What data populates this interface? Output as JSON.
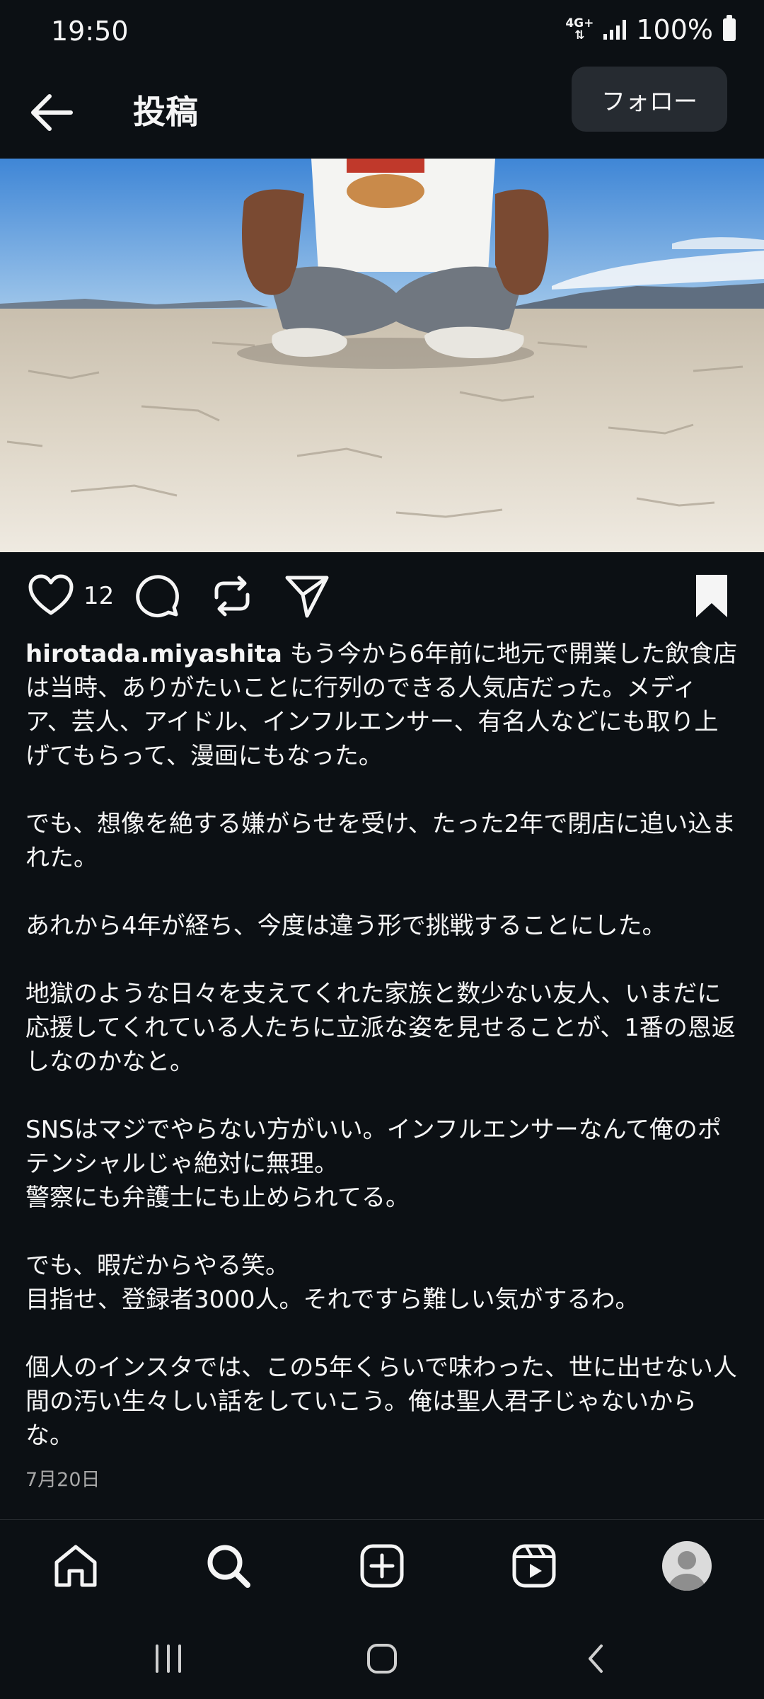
{
  "status_bar": {
    "time": "19:50",
    "network": "4G+",
    "battery": "100%"
  },
  "header": {
    "title": "投稿",
    "follow_label": "フォロー",
    "back_icon": "arrow-left-icon"
  },
  "post": {
    "like_count": "12",
    "username": "hirotada.miyashita",
    "caption_paragraphs": [
      [
        "もう今から6年前に地元で開業した飲食店は当時、ありがたいことに行列のできる人気店だった。メディア、芸人、アイドル、インフルエンサー、有名人などにも取り上げてもらって、漫画にもなった。"
      ],
      [
        "でも、想像を絶する嫌がらせを受け、たった2年で閉店に追い込まれた。"
      ],
      [
        "あれから4年が経ち、今度は違う形で挑戦することにした。"
      ],
      [
        "地獄のような日々を支えてくれた家族と数少ない友人、いまだに応援してくれている人たちに立派な姿を見せることが、1番の恩返しなのかなと。"
      ],
      [
        "SNSはマジでやらない方がいい。インフルエンサーなんて俺のポテンシャルじゃ絶対に無理。",
        "警察にも弁護士にも止められてる。"
      ],
      [
        "でも、暇だからやる笑。",
        "目指せ、登録者3000人。それですら難しい気がするわ。"
      ],
      [
        "個人のインスタでは、この5年くらいで味わった、世に出せない人間の汚い生々しい話をしていこう。俺は聖人君子じゃないからな。"
      ]
    ],
    "date": "7月20日"
  },
  "icons": {
    "like": "heart-icon",
    "comment": "comment-icon",
    "repost": "repost-icon",
    "share": "send-icon",
    "save": "bookmark-icon"
  },
  "bottom_nav": [
    "home-icon",
    "search-icon",
    "create-icon",
    "reels-icon",
    "profile-avatar"
  ],
  "colors": {
    "background": "#0c1014",
    "text": "#f5f5f5",
    "secondary_text": "#a8a8a8",
    "follow_button": "#262b31"
  }
}
